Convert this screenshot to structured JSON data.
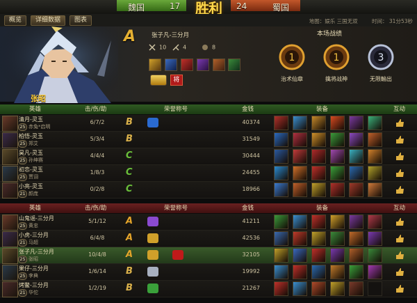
{
  "scoreboard": {
    "team_left": "魏国",
    "score_left": "17",
    "victory_text": "胜利",
    "score_right": "24",
    "team_right": "蜀国"
  },
  "tabs": [
    "概览",
    "详细数据",
    "图表"
  ],
  "map_info": {
    "map": "地图：娱乐 三国无双",
    "time": "时间： 31分53秒"
  },
  "hero": {
    "name": "张昭",
    "grade": "A",
    "player": "张子凡-三分月",
    "stats": [
      "10",
      "4",
      "8"
    ],
    "honor_badge": "将",
    "battle_title": "本场战绩",
    "medals": [
      {
        "label": "治术仙章",
        "num": "1"
      },
      {
        "label": "擒将战神",
        "num": "1"
      },
      {
        "label": "无限輸出",
        "num": "3"
      }
    ]
  },
  "columns": {
    "hero": "英雄",
    "kda": "击/伤/助",
    "honor": "荣誉称号",
    "gold": "金钱",
    "equip": "装备",
    "interact": "互动"
  },
  "team_green": [
    {
      "player": "清月-灵玉",
      "level": "25",
      "hero": "赤兔*启明",
      "kda": "6/7/2",
      "grade": "B",
      "honors": [
        "blue"
      ],
      "gold": "40374",
      "equip": [
        "#b0302a",
        "#3a8fd0",
        "#c78a2a",
        "#d84a20",
        "#7a3aa0",
        "#3ab07a"
      ]
    },
    {
      "player": "柏悟-灵玉",
      "level": "25",
      "hero": "郑艾",
      "kda": "5/3/4",
      "grade": "B",
      "honors": [],
      "gold": "31549",
      "equip": [
        "#2a6ac0",
        "#b03040",
        "#d0902a",
        "#3a9a3a",
        "#8a4ac0",
        "#c0602a"
      ]
    },
    {
      "player": "昊凡-灵玉",
      "level": "25",
      "hero": "孙坤赛",
      "kda": "4/4/4",
      "grade": "C",
      "honors": [],
      "gold": "30444",
      "equip": [
        "#2a5aa0",
        "#c03a3a",
        "#b02a2a",
        "#a04ab0",
        "#3ab0c0",
        "#d0802a"
      ]
    },
    {
      "player": "初恋-灵玉",
      "level": "25",
      "hero": "贾诩",
      "kda": "1/8/3",
      "grade": "C",
      "honors": [],
      "gold": "24455",
      "equip": [
        "#2a8ad0",
        "#d0702a",
        "#c0302a",
        "#3aa03a",
        "#2a6ab0",
        "#b0a02a"
      ]
    },
    {
      "player": "小亮-灵玉",
      "level": "21",
      "hero": "颜庞",
      "kda": "0/2/8",
      "grade": "C",
      "honors": [],
      "gold": "18966",
      "equip": [
        "#3a7ad0",
        "#c0602a",
        "#c0a02a",
        "#b0302a",
        "#a03a2a",
        "#d07a3a"
      ]
    }
  ],
  "team_red": [
    {
      "player": "山鬼谣-三分月",
      "level": "25",
      "hero": "黄忠",
      "kda": "5/1/12",
      "grade": "A",
      "honors": [
        "purple"
      ],
      "gold": "41211",
      "equip": [
        "#3a9a3a",
        "#3a8fd0",
        "#c0302a",
        "#d0a02a",
        "#7a3aa0",
        "#b03a4a"
      ]
    },
    {
      "player": "小虎-三分月",
      "level": "21",
      "hero": "马超",
      "kda": "6/4/8",
      "grade": "A",
      "honors": [
        "gold"
      ],
      "gold": "42536",
      "equip": [
        "#3a6ab0",
        "#c03a2a",
        "#c0a02a",
        "#3a8a3a",
        "#c06a2a",
        "#7a3ab0"
      ]
    },
    {
      "player": "张子凡-三分月",
      "level": "25",
      "hero": "张昭",
      "kda": "10/4/8",
      "grade": "A",
      "honors": [
        "gold",
        "red"
      ],
      "gold": "32105",
      "equip": [
        "#c0a02a",
        "#3a6ac0",
        "#c0302a",
        "#7a3ab0",
        "#b0602a",
        "#3a8a3a"
      ]
    },
    {
      "player": "果仔-三分月",
      "level": "25",
      "hero": "李典",
      "kda": "1/6/14",
      "grade": "B",
      "honors": [
        "silver"
      ],
      "gold": "19992",
      "equip": [
        "#3a8fd0",
        "#c0302a",
        "#2a6ab0",
        "#c07a2a",
        "#3aa03a",
        "#a03ab0"
      ]
    },
    {
      "player": "烤鳖-三分月",
      "level": "21",
      "hero": "华佗",
      "kda": "1/2/19",
      "grade": "B",
      "honors": [
        "green"
      ],
      "gold": "21267",
      "equip": [
        "#c0302a",
        "#3a8fd0",
        "#b04a2a",
        "#c0a02a",
        "#7a3a2a",
        ""
      ]
    }
  ]
}
